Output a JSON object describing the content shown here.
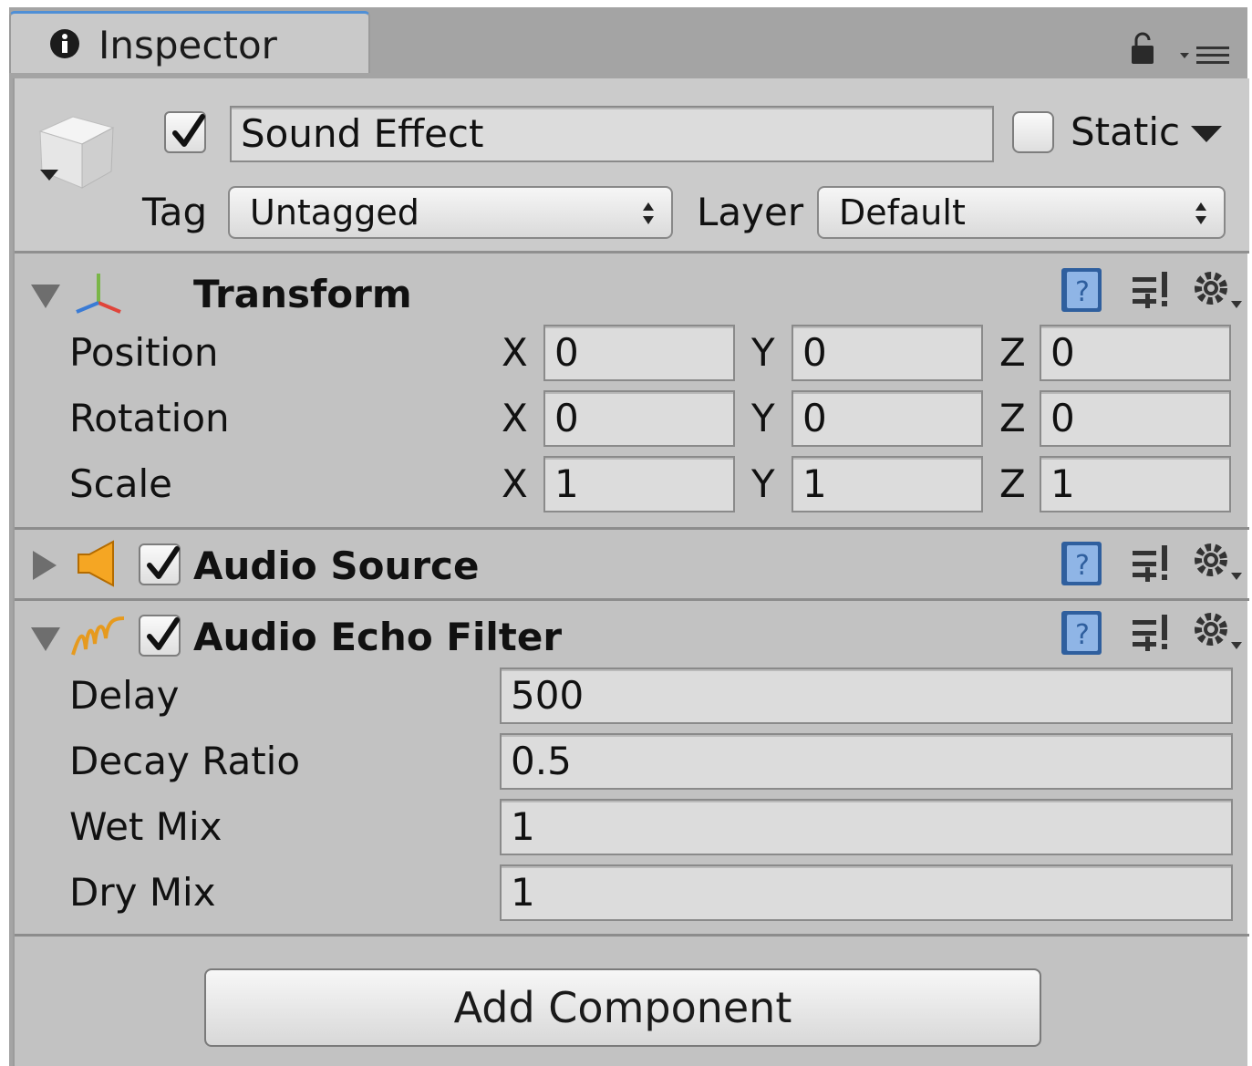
{
  "tab": {
    "label": "Inspector"
  },
  "gameobject": {
    "active": true,
    "name": "Sound Effect",
    "static_label": "Static",
    "static": false,
    "tag_label": "Tag",
    "tag_value": "Untagged",
    "layer_label": "Layer",
    "layer_value": "Default"
  },
  "transform": {
    "title": "Transform",
    "expanded": true,
    "rows": [
      {
        "label": "Position",
        "x": "0",
        "y": "0",
        "z": "0"
      },
      {
        "label": "Rotation",
        "x": "0",
        "y": "0",
        "z": "0"
      },
      {
        "label": "Scale",
        "x": "1",
        "y": "1",
        "z": "1"
      }
    ],
    "axes": {
      "x": "X",
      "y": "Y",
      "z": "Z"
    }
  },
  "audio_source": {
    "title": "Audio Source",
    "enabled": true,
    "expanded": false
  },
  "audio_echo_filter": {
    "title": "Audio Echo Filter",
    "enabled": true,
    "expanded": true,
    "fields": [
      {
        "label": "Delay",
        "value": "500"
      },
      {
        "label": "Decay Ratio",
        "value": "0.5"
      },
      {
        "label": "Wet Mix",
        "value": "1"
      },
      {
        "label": "Dry Mix",
        "value": "1"
      }
    ]
  },
  "add_component_label": "Add Component",
  "colors": {
    "accent_tab": "#4f8fd6",
    "speaker": "#f5a623",
    "check_blue": "#3a73c9"
  }
}
